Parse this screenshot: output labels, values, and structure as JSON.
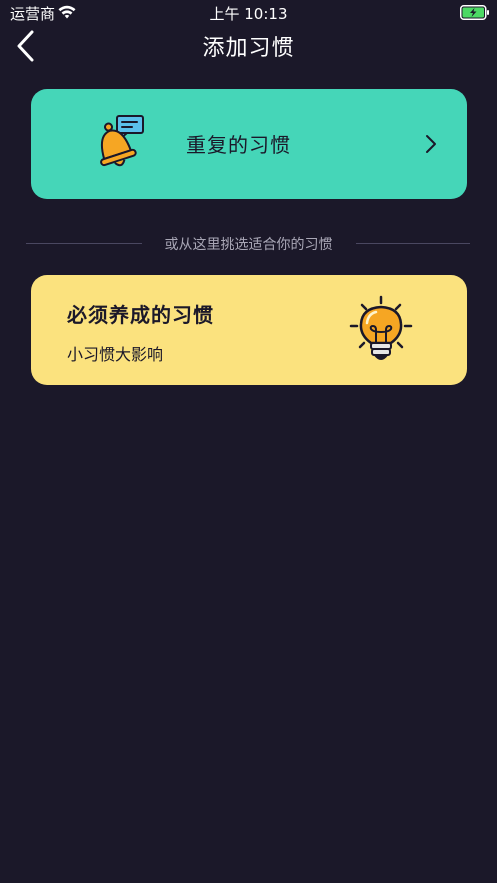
{
  "status_bar": {
    "carrier": "运营商",
    "time": "上午 10:13"
  },
  "nav": {
    "title": "添加习惯"
  },
  "repeat_card": {
    "label": "重复的习惯",
    "color": "#45d6b8"
  },
  "divider": {
    "text": "或从这里挑选适合你的习惯"
  },
  "must_card": {
    "title": "必须养成的习惯",
    "subtitle": "小习惯大影响",
    "color": "#fbe27e"
  },
  "icons": {
    "back": "chevron-left-icon",
    "bell": "bell-icon",
    "chevron": "chevron-right-icon",
    "bulb": "lightbulb-icon"
  },
  "colors": {
    "background": "#1b1829",
    "battery_fill": "#4cd964"
  }
}
